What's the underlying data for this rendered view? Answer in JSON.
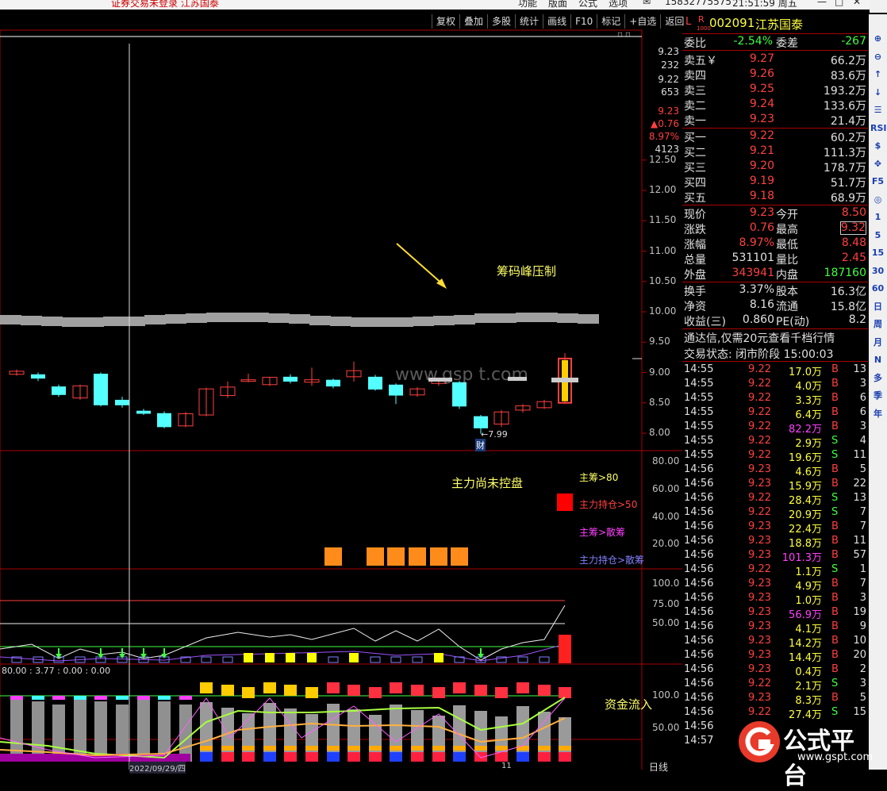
{
  "titlebar": {
    "notice": "证券交易未登录  江苏国泰",
    "menu": [
      "功能",
      "版面",
      "公式",
      "选项"
    ],
    "phone": "15832775575",
    "clock": "21:51:59 周五"
  },
  "toolbar": {
    "buttons": [
      "复权",
      "叠加",
      "多股",
      "统计",
      "画线",
      "F10",
      "标记",
      "+自选",
      "返回"
    ]
  },
  "stock": {
    "code": "002091",
    "name": "江苏国泰",
    "flag_l": "L",
    "flag_r": "R",
    "flag_sub": "1000"
  },
  "quote": {
    "weibi_label": "委比",
    "weibi": "-2.54%",
    "weicha_label": "委差",
    "weicha": "-267",
    "asks": [
      {
        "label": "卖五￥",
        "price": "9.27",
        "vol": "66.2万"
      },
      {
        "label": "卖四",
        "price": "9.26",
        "vol": "83.6万"
      },
      {
        "label": "卖三",
        "price": "9.25",
        "vol": "193.2万"
      },
      {
        "label": "卖二",
        "price": "9.24",
        "vol": "133.6万"
      },
      {
        "label": "卖一",
        "price": "9.23",
        "vol": "21.4万"
      }
    ],
    "bids": [
      {
        "label": "买一",
        "price": "9.22",
        "vol": "60.2万"
      },
      {
        "label": "买二",
        "price": "9.21",
        "vol": "111.3万"
      },
      {
        "label": "买三",
        "price": "9.20",
        "vol": "178.7万"
      },
      {
        "label": "买四",
        "price": "9.19",
        "vol": "51.7万"
      },
      {
        "label": "买五",
        "price": "9.18",
        "vol": "68.9万"
      }
    ],
    "stats": [
      {
        "l1": "现价",
        "v1": "9.23",
        "l2": "今开",
        "v2": "8.50"
      },
      {
        "l1": "涨跌",
        "v1": "0.76",
        "l2": "最高",
        "v2": "9.32"
      },
      {
        "l1": "涨幅",
        "v1": "8.97%",
        "l2": "最低",
        "v2": "8.48"
      },
      {
        "l1": "总量",
        "v1": "531101",
        "l2": "量比",
        "v2": "2.45"
      },
      {
        "l1": "外盘",
        "v1": "343941",
        "l2": "内盘",
        "v2": "187160"
      }
    ],
    "stats2": [
      {
        "l1": "换手",
        "v1": "3.37%",
        "l2": "股本",
        "v2": "16.3亿"
      },
      {
        "l1": "净资",
        "v1": "8.16",
        "l2": "流通",
        "v2": "15.8亿"
      },
      {
        "l1": "收益(三)",
        "v1": "0.860",
        "l2": "PE(动)",
        "v2": "8.2"
      }
    ],
    "promo": "通达信,仅需20元查看千档行情",
    "status": "交易状态: 闭市阶段 15:00:03"
  },
  "ticks": [
    {
      "t": "14:55",
      "p": "9.22",
      "v": "17.0万",
      "s": "B",
      "n": "13"
    },
    {
      "t": "14:55",
      "p": "9.22",
      "v": "4.0万",
      "s": "B",
      "n": "3"
    },
    {
      "t": "14:55",
      "p": "9.22",
      "v": "3.3万",
      "s": "B",
      "n": "6"
    },
    {
      "t": "14:55",
      "p": "9.22",
      "v": "6.4万",
      "s": "B",
      "n": "6"
    },
    {
      "t": "14:55",
      "p": "9.22",
      "v": "82.2万",
      "s": "B",
      "n": "3"
    },
    {
      "t": "14:55",
      "p": "9.22",
      "v": "2.9万",
      "s": "S",
      "n": "4"
    },
    {
      "t": "14:55",
      "p": "9.22",
      "v": "19.6万",
      "s": "S",
      "n": "11"
    },
    {
      "t": "14:56",
      "p": "9.23",
      "v": "4.6万",
      "s": "B",
      "n": "5"
    },
    {
      "t": "14:56",
      "p": "9.23",
      "v": "15.9万",
      "s": "B",
      "n": "22"
    },
    {
      "t": "14:56",
      "p": "9.22",
      "v": "28.4万",
      "s": "S",
      "n": "13"
    },
    {
      "t": "14:56",
      "p": "9.22",
      "v": "20.9万",
      "s": "S",
      "n": "7"
    },
    {
      "t": "14:56",
      "p": "9.23",
      "v": "22.4万",
      "s": "B",
      "n": "7"
    },
    {
      "t": "14:56",
      "p": "9.23",
      "v": "18.8万",
      "s": "B",
      "n": "11"
    },
    {
      "t": "14:56",
      "p": "9.23",
      "v": "101.3万",
      "s": "B",
      "n": "57"
    },
    {
      "t": "14:56",
      "p": "9.22",
      "v": "1.1万",
      "s": "S",
      "n": "1"
    },
    {
      "t": "14:56",
      "p": "9.23",
      "v": "4.9万",
      "s": "B",
      "n": "7"
    },
    {
      "t": "14:56",
      "p": "9.23",
      "v": "1.0万",
      "s": "B",
      "n": "3"
    },
    {
      "t": "14:56",
      "p": "9.23",
      "v": "56.9万",
      "s": "B",
      "n": "19"
    },
    {
      "t": "14:56",
      "p": "9.23",
      "v": "4.1万",
      "s": "B",
      "n": "9"
    },
    {
      "t": "14:56",
      "p": "9.23",
      "v": "14.2万",
      "s": "B",
      "n": "10"
    },
    {
      "t": "14:56",
      "p": "9.23",
      "v": "14.4万",
      "s": "B",
      "n": "20"
    },
    {
      "t": "14:56",
      "p": "9.23",
      "v": "0.4万",
      "s": "B",
      "n": "2"
    },
    {
      "t": "14:56",
      "p": "9.22",
      "v": "2.1万",
      "s": "S",
      "n": "3"
    },
    {
      "t": "14:56",
      "p": "9.23",
      "v": "8.3万",
      "s": "B",
      "n": "5"
    },
    {
      "t": "14:56",
      "p": "9.22",
      "v": "27.4万",
      "s": "S",
      "n": "15"
    },
    {
      "t": "14:56",
      "p": "",
      "v": "",
      "s": "",
      "n": ""
    },
    {
      "t": "14:57",
      "p": "",
      "v": "",
      "s": "",
      "n": ""
    }
  ],
  "sidebar": [
    "⊕",
    "⊖",
    "↑",
    "↓",
    "☰",
    "RSI",
    "$",
    "✥",
    "F5",
    "◎",
    "1",
    "5",
    "15",
    "30",
    "60",
    "日",
    "周",
    "月",
    "N",
    "多",
    "季",
    "年"
  ],
  "chart": {
    "price_axis": [
      "12.50",
      "12.00",
      "11.50",
      "11.00",
      "10.50",
      "10.00",
      "9.50",
      "9.00",
      "8.50",
      "8.00"
    ],
    "axis_info": [
      "9.23",
      "232",
      "9.22",
      "653",
      "9.23",
      "▲0.76",
      "8.97%",
      "4123"
    ],
    "ind1_axis": [
      "80.00",
      "60.00",
      "40.00",
      "20.00"
    ],
    "ind2_axis": [
      "100.0",
      "75.00",
      "50.00"
    ],
    "ind3_axis": [
      "100.0",
      "50.00"
    ],
    "annotation_chip": "筹码峰压制",
    "annotation_control": "主力尚未控盘",
    "annotation_inflow": "资金流入",
    "low_marker": "←7.99",
    "cai_marker": "财",
    "watermark": "www.gsp t.com",
    "legend": [
      {
        "text": "主筹>80",
        "color": "#ffff66"
      },
      {
        "text": "主力持仓>50",
        "color": "#ff4040"
      },
      {
        "text": "主筹>散筹",
        "color": "#ff40ff"
      },
      {
        "text": "主力持仓>散筹",
        "color": "#8080ff"
      }
    ],
    "ind3_values": "80.00 : 3.77 : 0.00 : 0.00",
    "date_label": "2022/09/29/四",
    "date_end": "11",
    "period_label": "日线"
  },
  "logo": {
    "text": "公式平台",
    "url": "www.gspt.com"
  }
}
